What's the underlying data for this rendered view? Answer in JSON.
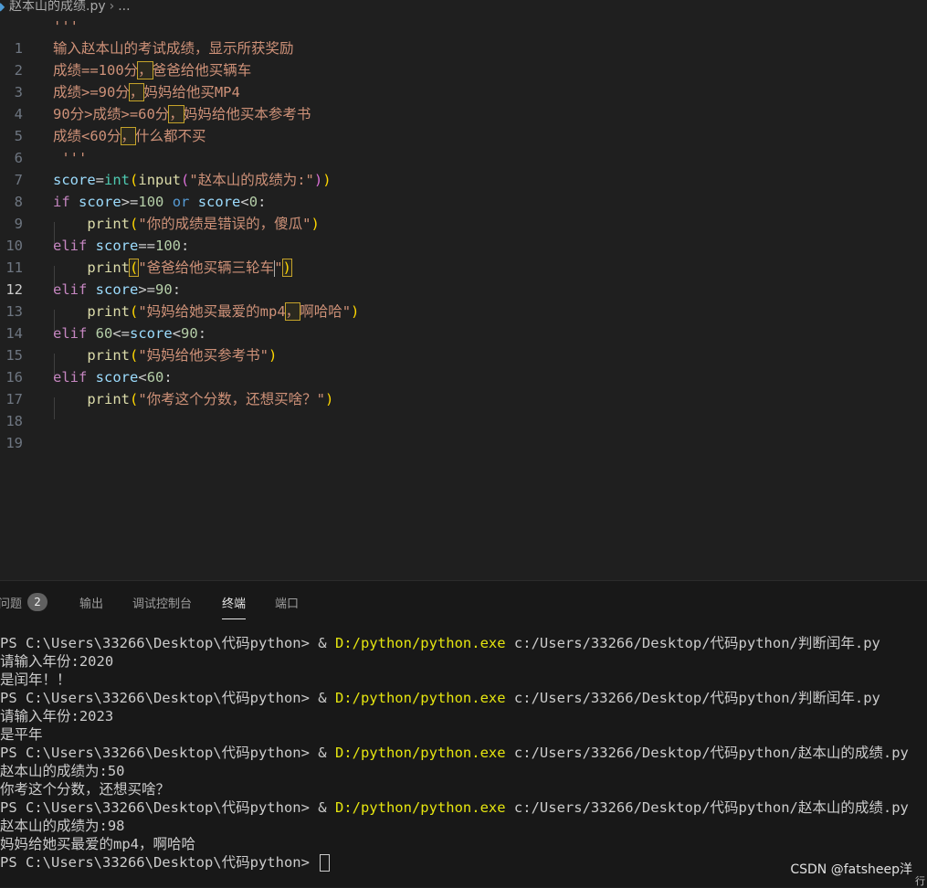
{
  "breadcrumb": {
    "file": "赵本山的成绩.py",
    "ellipsis": "..."
  },
  "editor": {
    "lines": [
      {
        "n": "1"
      },
      {
        "n": "2"
      },
      {
        "n": "3"
      },
      {
        "n": "4"
      },
      {
        "n": "5"
      },
      {
        "n": "6"
      },
      {
        "n": "7"
      },
      {
        "n": "8"
      },
      {
        "n": "9"
      },
      {
        "n": "10"
      },
      {
        "n": "11"
      },
      {
        "n": "12"
      },
      {
        "n": "13"
      },
      {
        "n": "14"
      },
      {
        "n": "15"
      },
      {
        "n": "16"
      },
      {
        "n": "17"
      },
      {
        "n": "18"
      },
      {
        "n": "19"
      }
    ],
    "code": {
      "l1": "'''",
      "l2": "输入赵本山的考试成绩，显示所获奖励",
      "l3a": "成绩==100分",
      "l3b": "，",
      "l3c": "爸爸给他买辆车",
      "l4a": "成绩>=90分",
      "l4b": "，",
      "l4c": "妈妈给他买MP4",
      "l5a": "90分>成绩>=60分",
      "l5b": "，",
      "l5c": "妈妈给他买本参考书",
      "l6a": "成绩<60分",
      "l6b": "，",
      "l6c": "什么都不买",
      "l7": " '''",
      "score": "score",
      "eq": "=",
      "int": "int",
      "lp": "(",
      "input": "input",
      "l8str": "\"赵本山的成绩为:\"",
      "rp": ")",
      "if": "if",
      "elif": "elif",
      "or": "or",
      "print": "print",
      "ge": ">=",
      "lt": "<",
      "eqeq": "==",
      "le": "<=",
      "colon": ":",
      "n100": "100",
      "n0": "0",
      "n90": "90",
      "n60": "60",
      "l10str": "\"你的成绩是错误的，傻瓜\"",
      "l12str_a": "\"爸爸给他买辆三轮车",
      "l12str_b": "\"",
      "l14str_a": "\"妈妈给她买最爱的mp4",
      "l14str_b": "，",
      "l14str_c": "啊哈哈\"",
      "l16str": "\"妈妈给他买参考书\"",
      "l18str": "\"你考这个分数，还想买啥？\""
    }
  },
  "panel": {
    "tabs": [
      {
        "label": "问题",
        "badge": "2"
      },
      {
        "label": "输出"
      },
      {
        "label": "调试控制台"
      },
      {
        "label": "终端"
      },
      {
        "label": "端口"
      }
    ],
    "terminal": {
      "prompt": "PS C:\\Users\\33266\\Desktop\\代码python> ",
      "amp": "& ",
      "exe": "D:/python/python.exe",
      "script1": " c:/Users/33266/Desktop/代码python/判断闰年.py",
      "out1": "请输入年份:2020",
      "out2": "是闰年！！",
      "out3": "请输入年份:2023",
      "out4": "是平年",
      "script2": " c:/Users/33266/Desktop/代码python/赵本山的成绩.py",
      "out5": "赵本山的成绩为:50",
      "out6": "你考这个分数，还想买啥？",
      "out7": "赵本山的成绩为:98",
      "out8": "妈妈给她买最爱的mp4，啊哈哈"
    }
  },
  "watermark": "CSDN @fatsheep洋",
  "corner_text": "行",
  "colors": {
    "background": "#1f1f1f",
    "string": "#ce9178",
    "keyword": "#c586c0",
    "variable": "#9cdcfe",
    "function": "#dcdcaa",
    "builtin_type": "#4ec9b0",
    "number": "#b5cea8",
    "terminal_exe": "#e5e510"
  }
}
